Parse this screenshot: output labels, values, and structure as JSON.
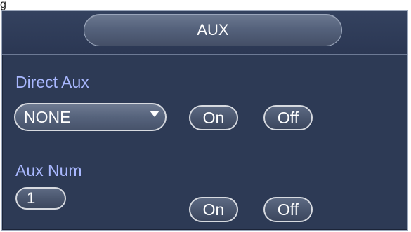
{
  "caption": "g",
  "window": {
    "title": "AUX"
  },
  "direct_aux": {
    "label": "Direct Aux",
    "selected": "NONE",
    "on_label": "On",
    "off_label": "Off"
  },
  "aux_num": {
    "label": "Aux Num",
    "value": "1",
    "on_label": "On",
    "off_label": "Off"
  },
  "icons": {
    "dropdown": "chevron-down-icon"
  },
  "colors": {
    "panel_bg": "#2d3a55",
    "label_text": "#a9b8ff",
    "button_text": "#ffffff",
    "button_border": "#d7dae0"
  }
}
